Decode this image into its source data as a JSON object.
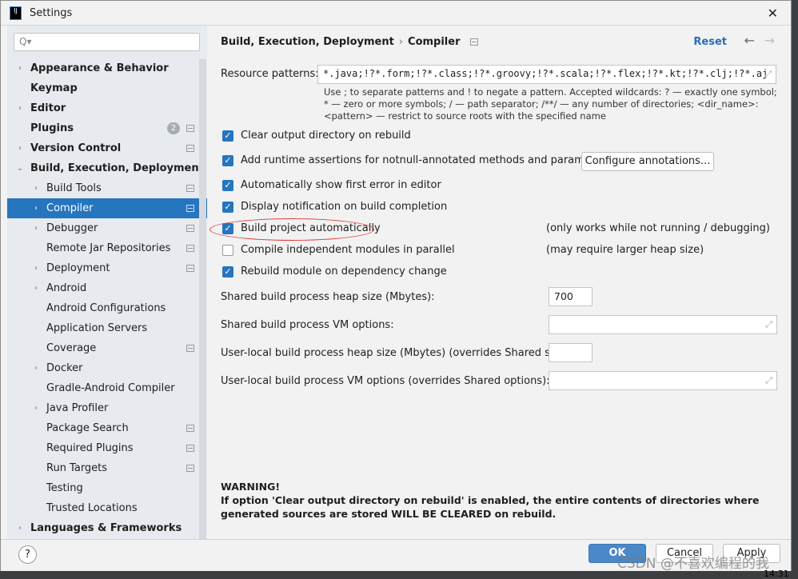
{
  "window": {
    "title": "Settings",
    "logo": "IJ"
  },
  "search": {
    "placeholder": "Q▾"
  },
  "sidebar": {
    "items": [
      {
        "label": "Appearance & Behavior",
        "level": 0,
        "arrow": true,
        "bold": true
      },
      {
        "label": "Keymap",
        "level": 0,
        "arrow": false,
        "bold": true
      },
      {
        "label": "Editor",
        "level": 0,
        "arrow": true,
        "bold": true
      },
      {
        "label": "Plugins",
        "level": 0,
        "arrow": false,
        "bold": true,
        "badge": "2",
        "cfg": true
      },
      {
        "label": "Version Control",
        "level": 0,
        "arrow": true,
        "bold": true,
        "cfg": true
      },
      {
        "label": "Build, Execution, Deployment",
        "level": 0,
        "arrow": "open",
        "bold": true
      },
      {
        "label": "Build Tools",
        "level": 1,
        "arrow": true,
        "cfg": true
      },
      {
        "label": "Compiler",
        "level": 1,
        "arrow": true,
        "cfg": true,
        "selected": true
      },
      {
        "label": "Debugger",
        "level": 1,
        "arrow": true,
        "cfg": true
      },
      {
        "label": "Remote Jar Repositories",
        "level": 1,
        "arrow": false,
        "cfg": true
      },
      {
        "label": "Deployment",
        "level": 1,
        "arrow": true,
        "cfg": true
      },
      {
        "label": "Android",
        "level": 1,
        "arrow": true
      },
      {
        "label": "Android Configurations",
        "level": 1,
        "arrow": false
      },
      {
        "label": "Application Servers",
        "level": 1,
        "arrow": false
      },
      {
        "label": "Coverage",
        "level": 1,
        "arrow": false,
        "cfg": true
      },
      {
        "label": "Docker",
        "level": 1,
        "arrow": true
      },
      {
        "label": "Gradle-Android Compiler",
        "level": 1,
        "arrow": false
      },
      {
        "label": "Java Profiler",
        "level": 1,
        "arrow": true
      },
      {
        "label": "Package Search",
        "level": 1,
        "arrow": false,
        "cfg": true
      },
      {
        "label": "Required Plugins",
        "level": 1,
        "arrow": false,
        "cfg": true
      },
      {
        "label": "Run Targets",
        "level": 1,
        "arrow": false,
        "cfg": true
      },
      {
        "label": "Testing",
        "level": 1,
        "arrow": false
      },
      {
        "label": "Trusted Locations",
        "level": 1,
        "arrow": false
      },
      {
        "label": "Languages & Frameworks",
        "level": 0,
        "arrow": true,
        "bold": true
      }
    ]
  },
  "header": {
    "crumb1": "Build, Execution, Deployment",
    "sep": "›",
    "crumb2": "Compiler",
    "reset": "Reset",
    "back": "←",
    "forward": "→"
  },
  "resource": {
    "label": "Resource patterns:",
    "value": "*.java;!?*.form;!?*.class;!?*.groovy;!?*.scala;!?*.flex;!?*.kt;!?*.clj;!?*.aj",
    "help": "Use ; to separate patterns and ! to negate a pattern. Accepted wildcards: ? — exactly one symbol; * — zero or more symbols; / — path separator; /**/ — any number of directories; <dir_name>:<pattern> — restrict to source roots with the specified name"
  },
  "options": [
    {
      "label": "Clear output directory on rebuild",
      "checked": true
    },
    {
      "label": "Add runtime assertions for notnull-annotated methods and parameters",
      "checked": true
    },
    {
      "label": "Automatically show first error in editor",
      "checked": true
    },
    {
      "label": "Display notification on build completion",
      "checked": true
    },
    {
      "label": "Build project automatically",
      "checked": true,
      "note": "(only works while not running / debugging)"
    },
    {
      "label": "Compile independent modules in parallel",
      "checked": false,
      "note": "(may require larger heap size)"
    },
    {
      "label": "Rebuild module on dependency change",
      "checked": true
    }
  ],
  "configure_annotations": "Configure annotations...",
  "fields": [
    {
      "label": "Shared build process heap size (Mbytes):",
      "value": "700"
    },
    {
      "label": "Shared build process VM options:",
      "value": ""
    },
    {
      "label": "User-local build process heap size (Mbytes) (overrides Shared size):",
      "value": ""
    },
    {
      "label": "User-local build process VM options (overrides Shared options):",
      "value": ""
    }
  ],
  "warning": {
    "title": "WARNING!",
    "text": "If option 'Clear output directory on rebuild' is enabled, the entire contents of directories where generated sources are stored WILL BE CLEARED on rebuild."
  },
  "footer": {
    "help": "?",
    "ok": "OK",
    "cancel": "Cancel",
    "apply": "Apply"
  },
  "watermark": "CSDN @不喜欢编程的我",
  "clock": "14:31",
  "colors": {
    "accent": "#2675bf",
    "highlight_oval": "#e03a3a",
    "link": "#2b6db5"
  }
}
